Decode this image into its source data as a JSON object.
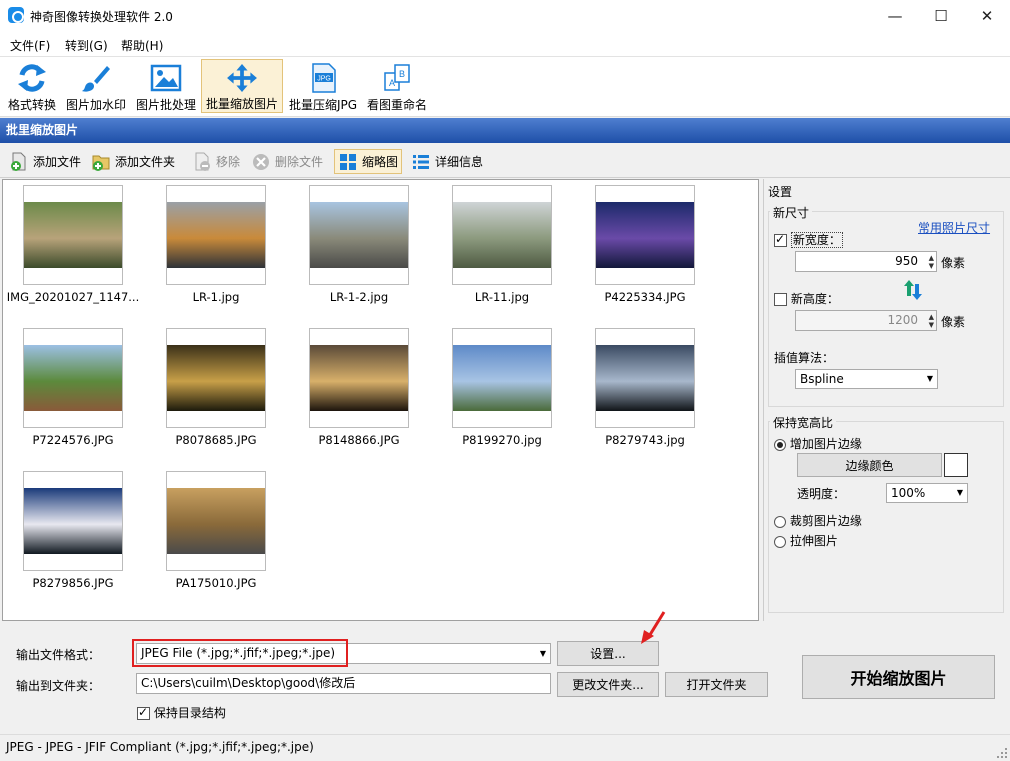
{
  "window": {
    "title": "神奇图像转换处理软件 2.0",
    "minimize": "—",
    "maximize": "☐",
    "close": "✕"
  },
  "menu": [
    "文件(F)",
    "转到(G)",
    "帮助(H)"
  ],
  "toolbar": [
    "格式转换",
    "图片加水印",
    "图片批处理",
    "批量缩放图片",
    "批量压缩JPG",
    "看图重命名"
  ],
  "toolbar_active": "批量缩放图片",
  "section_title": "批里缩放图片",
  "subtoolbar": {
    "add_file": "添加文件",
    "add_folder": "添加文件夹",
    "remove": "移除",
    "delete_file": "删除文件",
    "thumbnail": "缩略图",
    "details": "详细信息"
  },
  "thumbnails": [
    {
      "name": "IMG_20201027_1147...",
      "colors": [
        "#6c8a4a",
        "#b8a37a",
        "#3b4a2a"
      ]
    },
    {
      "name": "LR-1.jpg",
      "colors": [
        "#9aa0a6",
        "#c98a3a",
        "#2e3238"
      ]
    },
    {
      "name": "LR-1-2.jpg",
      "colors": [
        "#a8c4e0",
        "#8a8a7a",
        "#4a4a48"
      ]
    },
    {
      "name": "LR-11.jpg",
      "colors": [
        "#cfd4d6",
        "#8c9a7e",
        "#4e5a42"
      ]
    },
    {
      "name": "P4225334.JPG",
      "colors": [
        "#1c2a6a",
        "#6a4aa8",
        "#12183a"
      ]
    },
    {
      "name": "P7224576.JPG",
      "colors": [
        "#9cc0e4",
        "#5c8a3c",
        "#8a5a3a"
      ]
    },
    {
      "name": "P8078685.JPG",
      "colors": [
        "#3a3018",
        "#c8a048",
        "#1c1a0c"
      ]
    },
    {
      "name": "P8148866.JPG",
      "colors": [
        "#5a4a38",
        "#d8b06a",
        "#1c140c"
      ]
    },
    {
      "name": "P8199270.jpg",
      "colors": [
        "#5e8ac8",
        "#a8c4e4",
        "#4a6a3a"
      ]
    },
    {
      "name": "P8279743.jpg",
      "colors": [
        "#3a4a62",
        "#a8b8cc",
        "#101418"
      ]
    },
    {
      "name": "P8279856.JPG",
      "colors": [
        "#1a3a7a",
        "#e8e8f0",
        "#101820"
      ]
    },
    {
      "name": "PA175010.JPG",
      "colors": [
        "#c8a060",
        "#8a6a3a",
        "#4a4a4a"
      ]
    }
  ],
  "settings": {
    "title": "设置",
    "new_size_group": "新尺寸",
    "common_sizes_link": "常用照片尺寸",
    "new_width_label": "新宽度：",
    "width_value": "950",
    "unit1": "像素",
    "new_height_label": "新高度：",
    "height_value": "1200",
    "unit2": "像素",
    "interp_label": "插值算法：",
    "interp_value": "Bspline",
    "aspect_group": "保持宽高比",
    "add_border": "增加图片边缘",
    "border_color_btn": "边缘颜色",
    "opacity_label": "透明度：",
    "opacity_value": "100%",
    "crop_border": "裁剪图片边缘",
    "stretch": "拉伸图片"
  },
  "bottom": {
    "format_label": "输出文件格式：",
    "format_value": "JPEG File (*.jpg;*.jfif;*.jpeg;*.jpe)",
    "settings_btn": "设置...",
    "output_label": "输出到文件夹：",
    "output_path": "C:\\Users\\cuilm\\Desktop\\good\\修改后",
    "change_folder_btn": "更改文件夹...",
    "open_folder_btn": "打开文件夹",
    "keep_structure": "保持目录结构",
    "start_btn": "开始缩放图片"
  },
  "status": "JPEG - JPEG - JFIF Compliant (*.jpg;*.jfif;*.jpeg;*.jpe)",
  "colors": {
    "accent": "#1e4fa8",
    "highlight_box": "#e02020",
    "arrow": "#e02020"
  }
}
